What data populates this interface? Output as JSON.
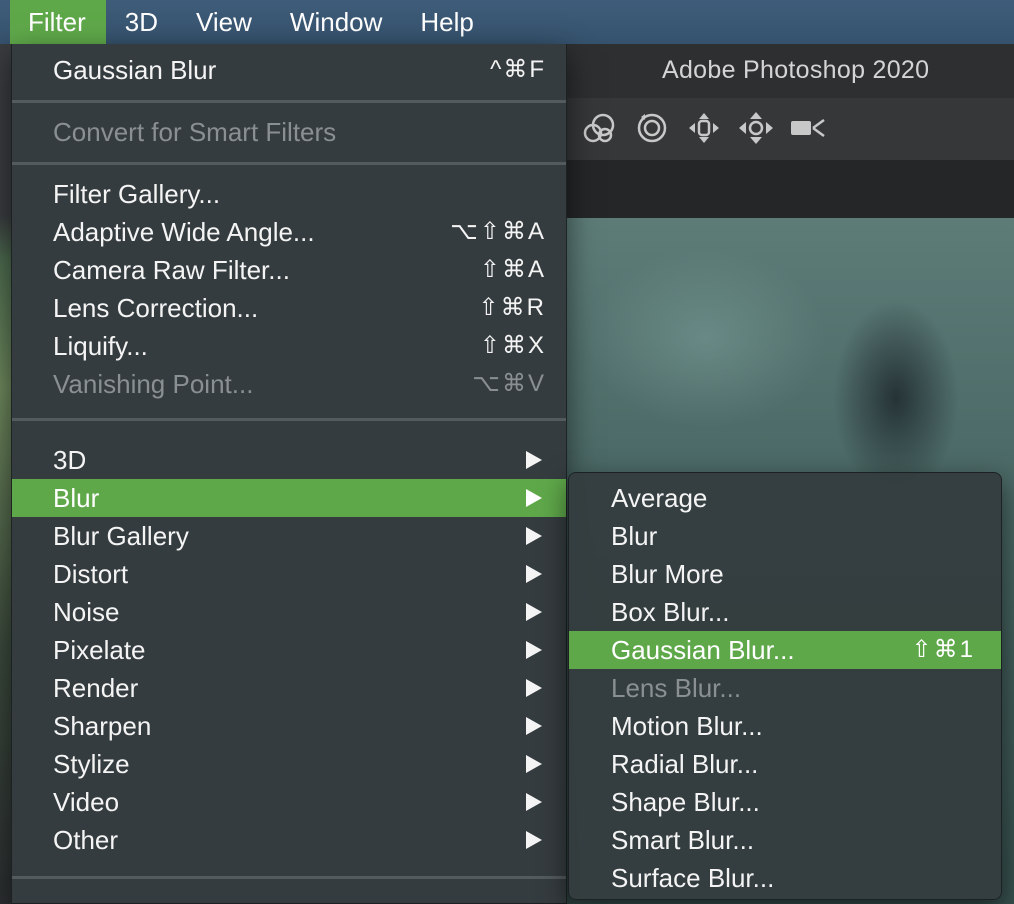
{
  "menubar": {
    "items": [
      "Filter",
      "3D",
      "View",
      "Window",
      "Help"
    ],
    "active": "Filter"
  },
  "window": {
    "title": "Adobe Photoshop 2020"
  },
  "toolbar": {
    "icons": [
      "orbit-3d-icon",
      "roll-3d-icon",
      "pan-3d-icon",
      "slide-3d-icon",
      "camera-3d-icon"
    ]
  },
  "filter_menu": {
    "last_filter": {
      "label": "Gaussian Blur",
      "shortcut": "^⌘F"
    },
    "convert_smart": {
      "label": "Convert for Smart Filters",
      "enabled": false
    },
    "gallery_items": [
      {
        "label": "Filter Gallery...",
        "shortcut": ""
      },
      {
        "label": "Adaptive Wide Angle...",
        "shortcut": "⌥⇧⌘A"
      },
      {
        "label": "Camera Raw Filter...",
        "shortcut": "⇧⌘A"
      },
      {
        "label": "Lens Correction...",
        "shortcut": "⇧⌘R"
      },
      {
        "label": "Liquify...",
        "shortcut": "⇧⌘X"
      },
      {
        "label": "Vanishing Point...",
        "shortcut": "⌥⌘V",
        "enabled": false
      }
    ],
    "submenus": [
      "3D",
      "Blur",
      "Blur Gallery",
      "Distort",
      "Noise",
      "Pixelate",
      "Render",
      "Sharpen",
      "Stylize",
      "Video",
      "Other"
    ],
    "highlighted": "Blur"
  },
  "blur_submenu": {
    "items": [
      {
        "label": "Average",
        "shortcut": ""
      },
      {
        "label": "Blur",
        "shortcut": ""
      },
      {
        "label": "Blur More",
        "shortcut": ""
      },
      {
        "label": "Box Blur...",
        "shortcut": ""
      },
      {
        "label": "Gaussian Blur...",
        "shortcut": "⇧⌘1",
        "highlighted": true
      },
      {
        "label": "Lens Blur...",
        "shortcut": "",
        "enabled": false
      },
      {
        "label": "Motion Blur...",
        "shortcut": ""
      },
      {
        "label": "Radial Blur...",
        "shortcut": ""
      },
      {
        "label": "Shape Blur...",
        "shortcut": ""
      },
      {
        "label": "Smart Blur...",
        "shortcut": ""
      },
      {
        "label": "Surface Blur...",
        "shortcut": ""
      }
    ]
  },
  "colors": {
    "highlight": "#5fa84a",
    "menubar": "#3a5773",
    "menu_bg": "#363e40",
    "disabled_text": "#8a9092"
  }
}
